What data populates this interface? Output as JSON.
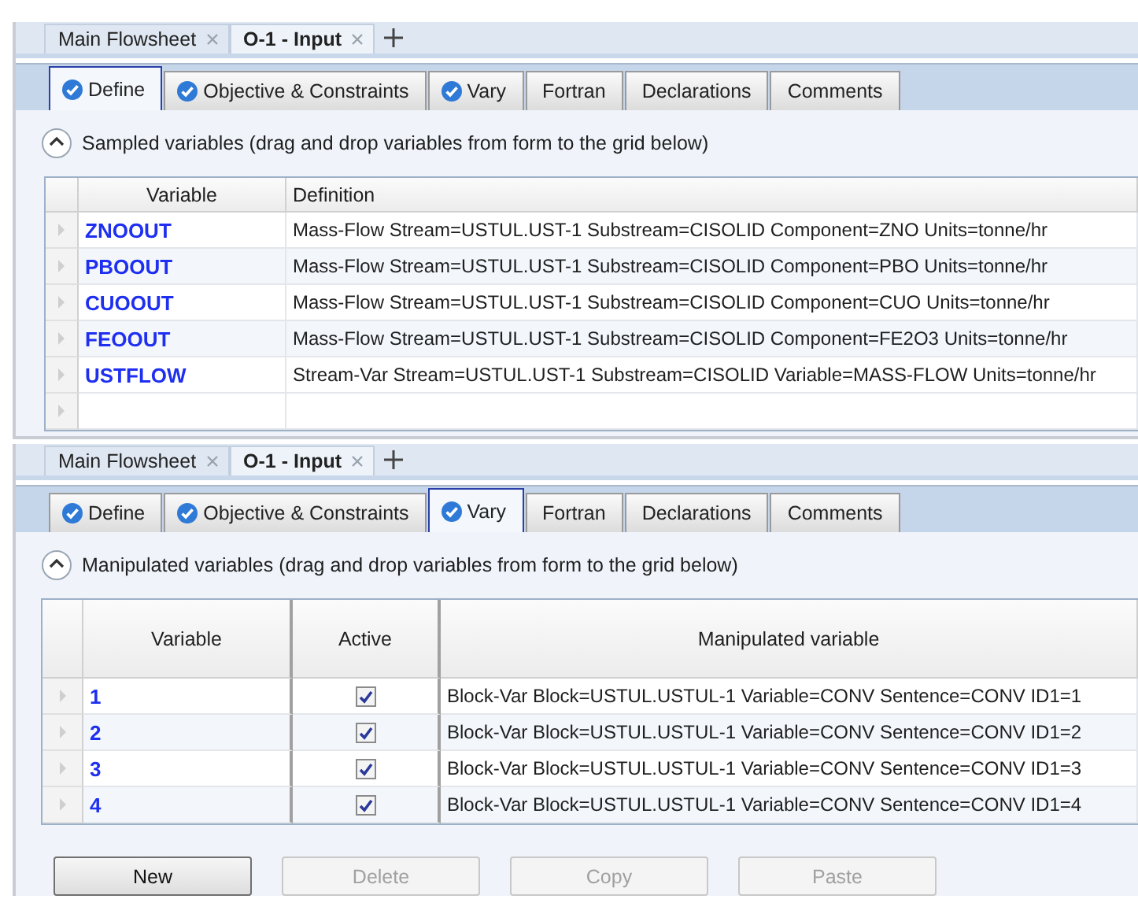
{
  "panels": [
    {
      "doc_tabs": [
        {
          "label": "Main Flowsheet",
          "selected": false
        },
        {
          "label": "O-1 - Input",
          "selected": true
        }
      ],
      "tabs": [
        {
          "label": "Define",
          "checked": true,
          "selected": true
        },
        {
          "label": "Objective & Constraints",
          "checked": true,
          "selected": false
        },
        {
          "label": "Vary",
          "checked": true,
          "selected": false
        },
        {
          "label": "Fortran",
          "checked": false,
          "selected": false
        },
        {
          "label": "Declarations",
          "checked": false,
          "selected": false
        },
        {
          "label": "Comments",
          "checked": false,
          "selected": false
        }
      ],
      "section": {
        "label": "Sampled variables (drag and drop variables from form to the grid below)",
        "expanded": true
      },
      "grid": {
        "kind": "sampled",
        "columns": [
          "Variable",
          "Definition"
        ],
        "rows": [
          {
            "variable": "ZNOOUT",
            "definition": "Mass-Flow Stream=USTUL.UST-1 Substream=CISOLID Component=ZNO Units=tonne/hr"
          },
          {
            "variable": "PBOOUT",
            "definition": "Mass-Flow Stream=USTUL.UST-1 Substream=CISOLID Component=PBO Units=tonne/hr"
          },
          {
            "variable": "CUOOUT",
            "definition": "Mass-Flow Stream=USTUL.UST-1 Substream=CISOLID Component=CUO Units=tonne/hr"
          },
          {
            "variable": "FEOOUT",
            "definition": "Mass-Flow Stream=USTUL.UST-1 Substream=CISOLID Component=FE2O3 Units=tonne/hr"
          },
          {
            "variable": "USTFLOW",
            "definition": "Stream-Var Stream=USTUL.UST-1 Substream=CISOLID Variable=MASS-FLOW Units=tonne/hr"
          }
        ]
      }
    },
    {
      "doc_tabs": [
        {
          "label": "Main Flowsheet",
          "selected": false
        },
        {
          "label": "O-1 - Input",
          "selected": true
        }
      ],
      "tabs": [
        {
          "label": "Define",
          "checked": true,
          "selected": false
        },
        {
          "label": "Objective & Constraints",
          "checked": true,
          "selected": false
        },
        {
          "label": "Vary",
          "checked": true,
          "selected": true
        },
        {
          "label": "Fortran",
          "checked": false,
          "selected": false
        },
        {
          "label": "Declarations",
          "checked": false,
          "selected": false
        },
        {
          "label": "Comments",
          "checked": false,
          "selected": false
        }
      ],
      "section": {
        "label": "Manipulated variables (drag and drop variables from form to the grid below)",
        "expanded": true
      },
      "grid": {
        "kind": "manipulated",
        "columns": [
          "Variable",
          "Active",
          "Manipulated variable"
        ],
        "rows": [
          {
            "variable": "1",
            "active": true,
            "definition": "Block-Var Block=USTUL.USTUL-1 Variable=CONV Sentence=CONV ID1=1"
          },
          {
            "variable": "2",
            "active": true,
            "definition": "Block-Var Block=USTUL.USTUL-1 Variable=CONV Sentence=CONV ID1=2"
          },
          {
            "variable": "3",
            "active": true,
            "definition": "Block-Var Block=USTUL.USTUL-1 Variable=CONV Sentence=CONV ID1=3"
          },
          {
            "variable": "4",
            "active": true,
            "definition": "Block-Var Block=USTUL.USTUL-1 Variable=CONV Sentence=CONV ID1=4"
          }
        ]
      },
      "buttons": [
        {
          "label": "New",
          "disabled": false
        },
        {
          "label": "Delete",
          "disabled": true
        },
        {
          "label": "Copy",
          "disabled": true
        },
        {
          "label": "Paste",
          "disabled": true
        }
      ]
    }
  ]
}
